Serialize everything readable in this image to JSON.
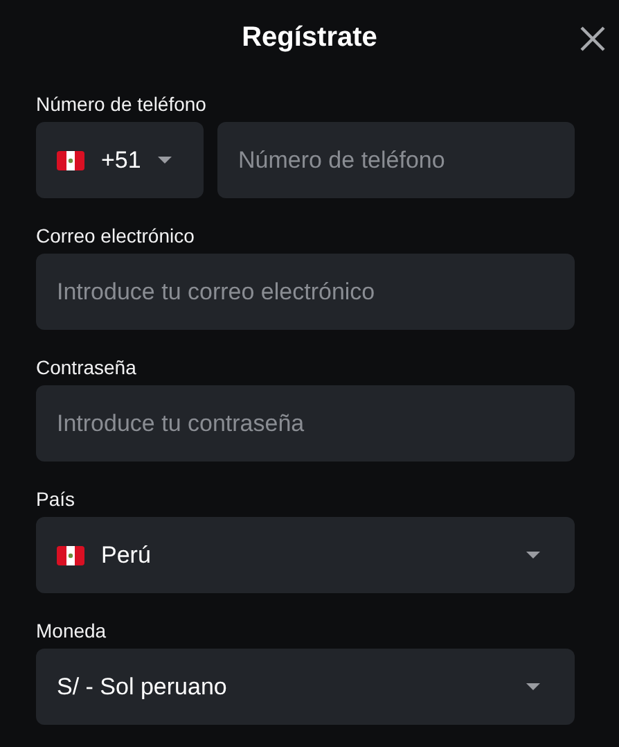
{
  "title": "Regístrate",
  "fields": [
    {
      "kind": "phone",
      "label": "Número de teléfono",
      "code": "+51",
      "flag": true,
      "placeholder": "Número de teléfono"
    },
    {
      "kind": "text",
      "label": "Correo electrónico",
      "placeholder": "Introduce tu correo electrónico"
    },
    {
      "kind": "text",
      "label": "Contraseña",
      "placeholder": "Introduce tu contraseña"
    },
    {
      "kind": "select",
      "label": "País",
      "flag": true,
      "value": "Perú"
    },
    {
      "kind": "select",
      "label": "Moneda",
      "value": "S/ - Sol peruano"
    }
  ]
}
